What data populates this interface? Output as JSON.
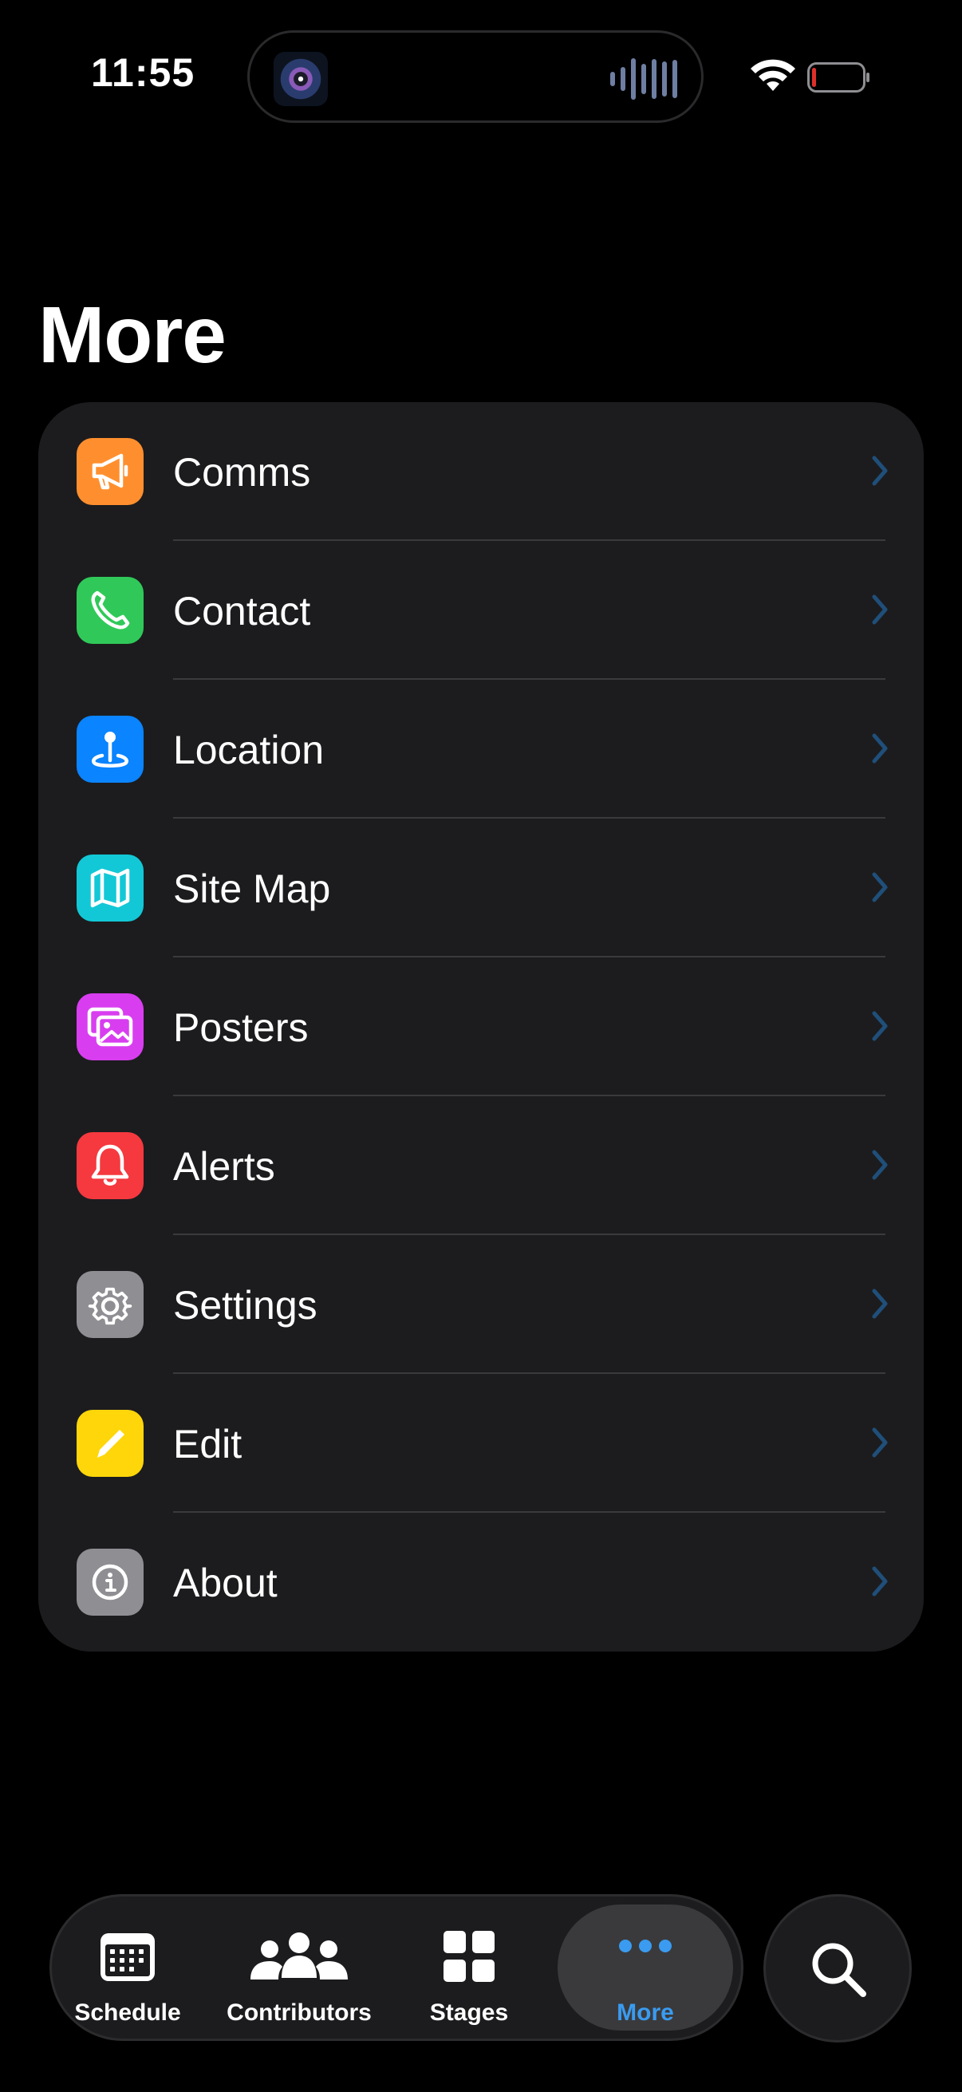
{
  "status_bar": {
    "time": "11:55",
    "battery_color": "#e0302b"
  },
  "page": {
    "title": "More"
  },
  "menu": {
    "items": [
      {
        "label": "Comms",
        "icon": "megaphone-icon",
        "color": "#ff8f2e"
      },
      {
        "label": "Contact",
        "icon": "phone-icon",
        "color": "#30c959"
      },
      {
        "label": "Location",
        "icon": "map-pin-icon",
        "color": "#0a84ff"
      },
      {
        "label": "Site Map",
        "icon": "map-icon",
        "color": "#12c8d6"
      },
      {
        "label": "Posters",
        "icon": "photos-icon",
        "color": "#d83ef0"
      },
      {
        "label": "Alerts",
        "icon": "bell-icon",
        "color": "#f5393f"
      },
      {
        "label": "Settings",
        "icon": "gear-icon",
        "color": "#8e8e93"
      },
      {
        "label": "Edit",
        "icon": "pencil-icon",
        "color": "#ffd60a"
      },
      {
        "label": "About",
        "icon": "info-icon",
        "color": "#8e8e93"
      }
    ],
    "chevron_color": "#1f4f7a"
  },
  "tab_bar": {
    "tabs": [
      {
        "label": "Schedule",
        "icon": "calendar-icon",
        "active": false
      },
      {
        "label": "Contributors",
        "icon": "people-icon",
        "active": false
      },
      {
        "label": "Stages",
        "icon": "grid-icon",
        "active": false
      },
      {
        "label": "More",
        "icon": "ellipsis-icon",
        "active": true
      }
    ],
    "active_color": "#3a9bf0",
    "search_icon": "search-icon"
  }
}
